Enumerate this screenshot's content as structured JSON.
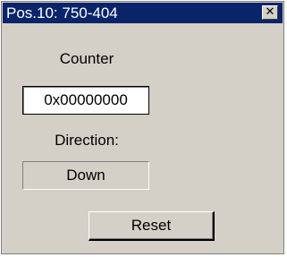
{
  "window": {
    "title": "Pos.10: 750-404",
    "close_glyph": "✕",
    "close_icon": "close-icon"
  },
  "counter": {
    "label": "Counter",
    "value": "0x00000000"
  },
  "direction": {
    "label": "Direction:",
    "value": "Down"
  },
  "actions": {
    "reset_label": "Reset"
  },
  "colors": {
    "titlebar": "#0a246a",
    "title_text": "#ffffff",
    "window_face": "#d4d0c8",
    "field_bg": "#ffffff"
  }
}
